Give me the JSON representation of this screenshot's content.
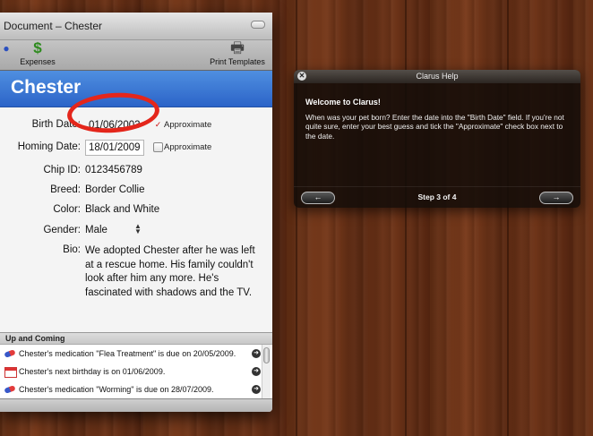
{
  "window": {
    "title": "Document – Chester"
  },
  "toolbar": {
    "expenses_label": "Expenses",
    "print_label": "Print Templates",
    "left_icon": "action-icon",
    "expenses_icon": "money-bag-icon",
    "print_icon": "printer-icon"
  },
  "pet": {
    "name": "Chester",
    "fields": {
      "birth_date_label": "Birth Date:",
      "birth_date_value": "01/06/2003",
      "birth_approx_label": "Approximate",
      "birth_approx_checked": true,
      "homing_date_label": "Homing Date:",
      "homing_date_value": "18/01/2009",
      "homing_approx_label": "Approximate",
      "homing_approx_checked": false,
      "chip_label": "Chip ID:",
      "chip_value": "0123456789",
      "breed_label": "Breed:",
      "breed_value": "Border Collie",
      "color_label": "Color:",
      "color_value": "Black and White",
      "gender_label": "Gender:",
      "gender_value": "Male",
      "bio_label": "Bio:",
      "bio_value": "We adopted Chester after he was left at a rescue home. His family couldn't look after him any more. He's fascinated with shadows and the TV."
    }
  },
  "upcoming": {
    "header": "Up and Coming",
    "items": [
      {
        "icon": "pill-icon",
        "text": "Chester's medication \"Flea Treatment\" is due on 20/05/2009."
      },
      {
        "icon": "calendar-icon",
        "text": "Chester's next birthday is on 01/06/2009."
      },
      {
        "icon": "pill-icon",
        "text": "Chester's medication \"Worming\" is due on 28/07/2009."
      }
    ]
  },
  "help": {
    "title": "Clarus Help",
    "heading": "Welcome to Clarus!",
    "body": "When was your pet born? Enter the date into the \"Birth Date\" field. If you're not quite sure, enter your best guess and tick the \"Approximate\" check box next to the date.",
    "step": "Step 3 of 4",
    "prev_label": "←",
    "next_label": "→"
  },
  "colors": {
    "header_blue": "#2c64c8",
    "highlight_red": "#e4261b",
    "wood": "#652f15"
  }
}
